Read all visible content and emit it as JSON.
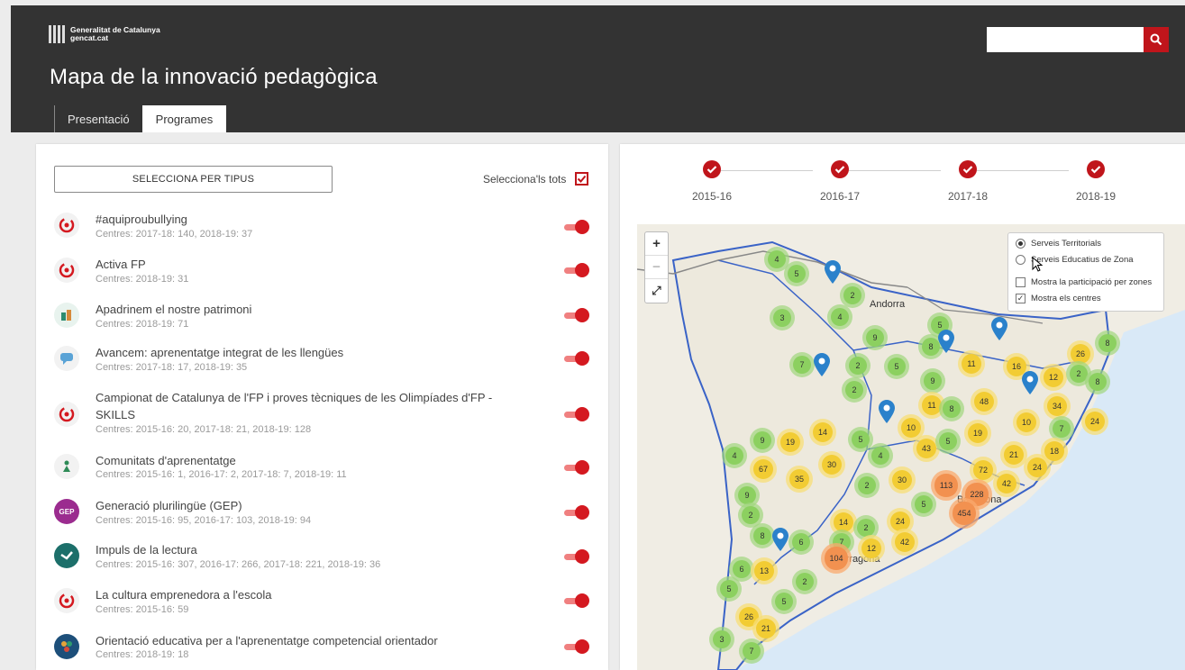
{
  "header": {
    "logo_line1": "Generalitat de Catalunya",
    "logo_line2": "gencat.cat",
    "title": "Mapa de la innovació pedagògica",
    "search_placeholder": "",
    "tabs": [
      {
        "label": "Presentació",
        "active": false
      },
      {
        "label": "Programes",
        "active": true
      }
    ]
  },
  "filters": {
    "type_button": "SELECCIONA PER TIPUS",
    "select_all_label": "Selecciona'ls tots",
    "select_all_checked": true
  },
  "programs": [
    {
      "name": "#aquiproubullying",
      "meta": "Centres: 2017-18: 140, 2018-19: 37",
      "icon": "target-icon",
      "enabled": true
    },
    {
      "name": "Activa FP",
      "meta": "Centres: 2018-19: 31",
      "icon": "target-icon",
      "enabled": true
    },
    {
      "name": "Apadrinem el nostre patrimoni",
      "meta": "Centres: 2018-19: 71",
      "icon": "heritage-icon",
      "enabled": true
    },
    {
      "name": "Avancem: aprenentatge integrat de les llengües",
      "meta": "Centres: 2017-18: 17, 2018-19: 35",
      "icon": "speech-bubble-icon",
      "enabled": true
    },
    {
      "name": "Campionat de Catalunya de l'FP i proves tècniques de les Olimpíades d'FP - SKILLS",
      "meta": "Centres: 2015-16: 20, 2017-18: 21, 2018-19: 128",
      "icon": "target-icon",
      "enabled": true
    },
    {
      "name": "Comunitats d'aprenentatge",
      "meta": "Centres: 2015-16: 1, 2016-17: 2, 2017-18: 7, 2018-19: 11",
      "icon": "community-icon",
      "enabled": true
    },
    {
      "name": "Generació plurilingüe (GEP)",
      "meta": "Centres: 2015-16: 95, 2016-17: 103, 2018-19: 94",
      "icon": "gep-icon",
      "icon_text": "GEP",
      "enabled": true
    },
    {
      "name": "Impuls de la lectura",
      "meta": "Centres: 2015-16: 307, 2016-17: 266, 2017-18: 221, 2018-19: 36",
      "icon": "reading-icon",
      "enabled": true
    },
    {
      "name": "La cultura emprenedora a l'escola",
      "meta": "Centres: 2015-16: 59",
      "icon": "target-icon",
      "enabled": true
    },
    {
      "name": "Orientació educativa per a l'aprenentatge competencial orientador",
      "meta": "Centres: 2018-19: 18",
      "icon": "orientation-icon",
      "enabled": true
    }
  ],
  "timeline": {
    "years": [
      "2015-16",
      "2016-17",
      "2017-18",
      "2018-19"
    ],
    "all_checked": true
  },
  "map": {
    "zoom_in": "+",
    "zoom_out": "−",
    "fullscreen": "⤢",
    "layers": {
      "serveis_territorials": "Serveis Territorials",
      "serveis_educatius": "Serveis Educatius de Zona",
      "participacio": "Mostra la participació per zones",
      "centres": "Mostra els centres",
      "selected_layer": "Serveis Territorials",
      "participacio_checked": false,
      "centres_checked": true
    },
    "place_labels": [
      "Andorra",
      "Barcelona",
      "Tarragona"
    ],
    "clusters": [
      {
        "v": "4",
        "c": "g"
      },
      {
        "v": "5",
        "c": "g"
      },
      {
        "v": "2",
        "c": "g"
      },
      {
        "v": "3",
        "c": "g"
      },
      {
        "v": "4",
        "c": "g"
      },
      {
        "v": "9",
        "c": "g"
      },
      {
        "v": "7",
        "c": "g"
      },
      {
        "v": "2",
        "c": "g"
      },
      {
        "v": "5",
        "c": "g"
      },
      {
        "v": "2",
        "c": "g"
      },
      {
        "v": "5",
        "c": "g"
      },
      {
        "v": "8",
        "c": "g"
      },
      {
        "v": "11",
        "c": "y"
      },
      {
        "v": "9",
        "c": "g"
      },
      {
        "v": "16",
        "c": "y"
      },
      {
        "v": "26",
        "c": "y"
      },
      {
        "v": "8",
        "c": "g"
      },
      {
        "v": "12",
        "c": "y"
      },
      {
        "v": "2",
        "c": "g"
      },
      {
        "v": "8",
        "c": "g"
      },
      {
        "v": "11",
        "c": "y"
      },
      {
        "v": "8",
        "c": "g"
      },
      {
        "v": "48",
        "c": "y"
      },
      {
        "v": "34",
        "c": "y"
      },
      {
        "v": "10",
        "c": "y"
      },
      {
        "v": "10",
        "c": "y"
      },
      {
        "v": "7",
        "c": "g"
      },
      {
        "v": "24",
        "c": "y"
      },
      {
        "v": "9",
        "c": "g"
      },
      {
        "v": "19",
        "c": "y"
      },
      {
        "v": "14",
        "c": "y"
      },
      {
        "v": "5",
        "c": "g"
      },
      {
        "v": "43",
        "c": "y"
      },
      {
        "v": "5",
        "c": "g"
      },
      {
        "v": "19",
        "c": "y"
      },
      {
        "v": "21",
        "c": "y"
      },
      {
        "v": "18",
        "c": "y"
      },
      {
        "v": "4",
        "c": "g"
      },
      {
        "v": "67",
        "c": "y"
      },
      {
        "v": "30",
        "c": "y"
      },
      {
        "v": "4",
        "c": "g"
      },
      {
        "v": "24",
        "c": "y"
      },
      {
        "v": "35",
        "c": "y"
      },
      {
        "v": "72",
        "c": "y"
      },
      {
        "v": "2",
        "c": "g"
      },
      {
        "v": "30",
        "c": "y"
      },
      {
        "v": "113",
        "c": "o"
      },
      {
        "v": "42",
        "c": "y"
      },
      {
        "v": "9",
        "c": "g"
      },
      {
        "v": "228",
        "c": "o"
      },
      {
        "v": "5",
        "c": "g"
      },
      {
        "v": "454",
        "c": "o"
      },
      {
        "v": "2",
        "c": "g"
      },
      {
        "v": "14",
        "c": "y"
      },
      {
        "v": "2",
        "c": "g"
      },
      {
        "v": "24",
        "c": "y"
      },
      {
        "v": "8",
        "c": "g"
      },
      {
        "v": "6",
        "c": "g"
      },
      {
        "v": "7",
        "c": "g"
      },
      {
        "v": "42",
        "c": "y"
      },
      {
        "v": "12",
        "c": "y"
      },
      {
        "v": "104",
        "c": "o"
      },
      {
        "v": "6",
        "c": "g"
      },
      {
        "v": "13",
        "c": "y"
      },
      {
        "v": "2",
        "c": "g"
      },
      {
        "v": "5",
        "c": "g"
      },
      {
        "v": "5",
        "c": "g"
      },
      {
        "v": "26",
        "c": "y"
      },
      {
        "v": "21",
        "c": "y"
      },
      {
        "v": "3",
        "c": "g"
      },
      {
        "v": "7",
        "c": "g"
      }
    ]
  },
  "colors": {
    "header_bg": "#333333",
    "accent_red": "#c0151b",
    "cluster_green": "#8cd060",
    "cluster_yellow": "#f2cc33",
    "cluster_orange": "#f29150",
    "pin_blue": "#2a81cb"
  }
}
